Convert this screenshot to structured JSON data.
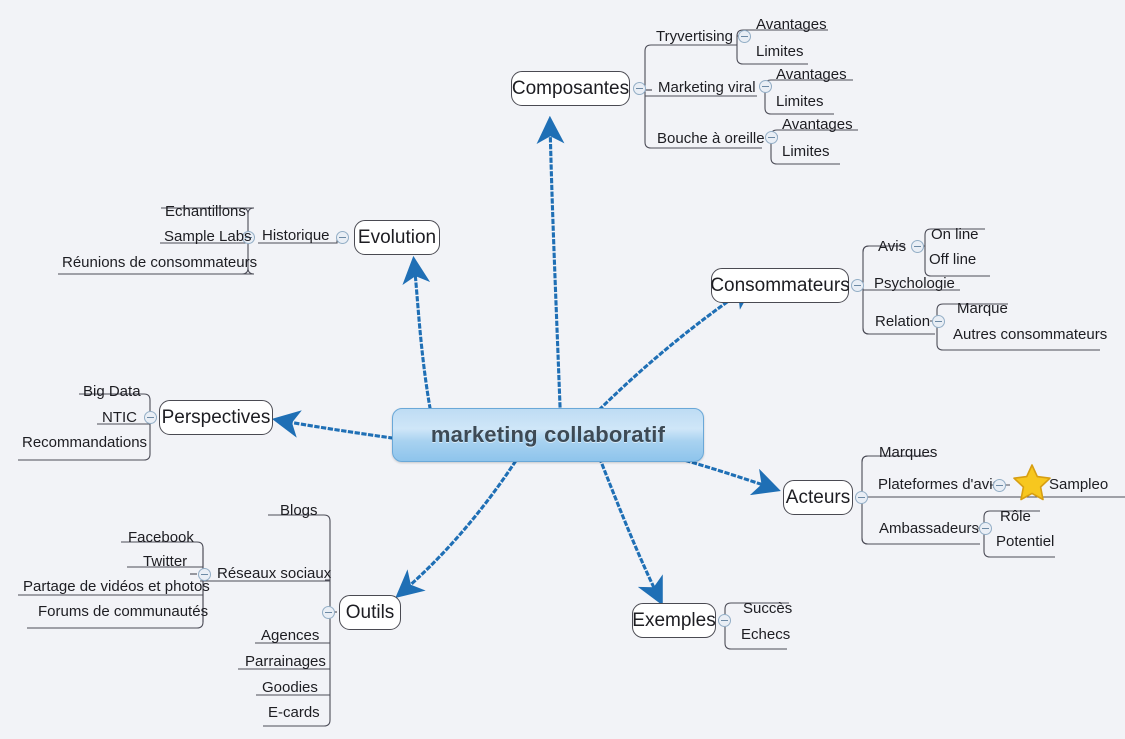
{
  "canvas": {
    "background": "#f2f3f7",
    "connector_color": "#1f6fb5",
    "branch_line_color": "#4c4c57",
    "root_fill_top": "#cfe6f8",
    "root_fill_bottom": "#8ec4ec",
    "star_color": "#f5c026"
  },
  "root": {
    "label": "marketing collaboratif"
  },
  "branches": {
    "composantes": {
      "label": "Composantes",
      "children": [
        {
          "label": "Tryvertising",
          "children": [
            {
              "label": "Avantages"
            },
            {
              "label": "Limites"
            }
          ]
        },
        {
          "label": "Marketing viral",
          "children": [
            {
              "label": "Avantages"
            },
            {
              "label": "Limites"
            }
          ]
        },
        {
          "label": "Bouche à oreille",
          "children": [
            {
              "label": "Avantages"
            },
            {
              "label": "Limites"
            }
          ]
        }
      ]
    },
    "evolution": {
      "label": "Evolution",
      "children": [
        {
          "label": "Historique",
          "children": [
            {
              "label": "Echantillons"
            },
            {
              "label": "Sample Labs"
            },
            {
              "label": "Réunions de consommateurs"
            }
          ]
        }
      ]
    },
    "consommateurs": {
      "label": "Consommateurs",
      "children": [
        {
          "label": "Avis",
          "children": [
            {
              "label": "On line"
            },
            {
              "label": "Off line"
            }
          ]
        },
        {
          "label": "Psychologie",
          "children": []
        },
        {
          "label": "Relation",
          "children": [
            {
              "label": "Marque"
            },
            {
              "label": "Autres consommateurs"
            }
          ]
        }
      ]
    },
    "perspectives": {
      "label": "Perspectives",
      "children": [
        {
          "label": "Big Data"
        },
        {
          "label": "NTIC"
        },
        {
          "label": "Recommandations"
        }
      ]
    },
    "acteurs": {
      "label": "Acteurs",
      "children": [
        {
          "label": "Marques"
        },
        {
          "label": "Plateformes d'avis",
          "children": [
            {
              "label": "Sampleo",
              "marker": "star-icon"
            }
          ]
        },
        {
          "label": "Ambassadeurs",
          "children": [
            {
              "label": "Rôle"
            },
            {
              "label": "Potentiel"
            }
          ]
        }
      ]
    },
    "outils": {
      "label": "Outils",
      "children": [
        {
          "label": "Blogs"
        },
        {
          "label": "Réseaux sociaux",
          "children": [
            {
              "label": "Facebook"
            },
            {
              "label": "Twitter"
            },
            {
              "label": "Partage de vidéos et photos"
            },
            {
              "label": "Forums de communautés"
            }
          ]
        },
        {
          "label": "Agences"
        },
        {
          "label": "Parrainages"
        },
        {
          "label": "Goodies"
        },
        {
          "label": "E-cards"
        }
      ]
    },
    "exemples": {
      "label": "Exemples",
      "children": [
        {
          "label": "Succès"
        },
        {
          "label": "Echecs"
        }
      ]
    }
  }
}
